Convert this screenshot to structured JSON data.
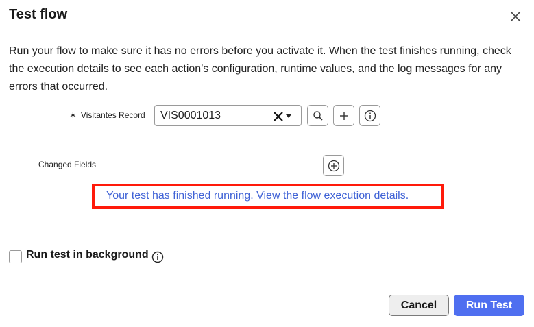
{
  "dialog": {
    "title": "Test flow",
    "description": "Run your flow to make sure it has no errors before you activate it. When the test finishes running, check the execution details to see each action's configuration, runtime values, and the log messages for any errors that occurred."
  },
  "record": {
    "required_mark": "∗",
    "label": "Visitantes Record",
    "value": "VIS0001013"
  },
  "changed_fields": {
    "label": "Changed Fields"
  },
  "result": {
    "link_text": "Your test has finished running. View the flow execution details."
  },
  "background": {
    "label": "Run test in background",
    "checked": false
  },
  "footer": {
    "cancel_label": "Cancel",
    "run_label": "Run Test"
  },
  "colors": {
    "accent": "#4f6ff0",
    "link": "#3f62d6",
    "highlight": "#ff1a0a"
  }
}
